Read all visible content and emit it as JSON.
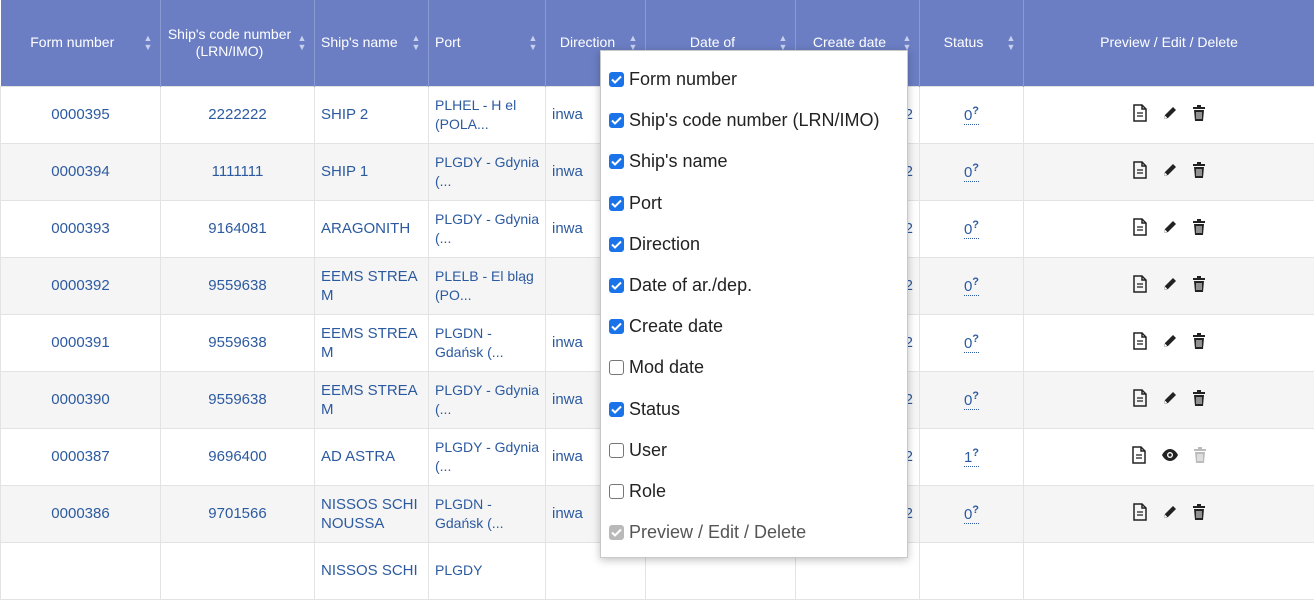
{
  "table": {
    "headers": {
      "form_number": "Form number",
      "ship_code": "Ship's code number (LRN/IMO)",
      "ship_name": "Ship's name",
      "port": "Port",
      "direction": "Direction",
      "date": "Date of",
      "create_date": "Create date",
      "status": "Status",
      "actions": "Preview / Edit / Delete"
    },
    "rows": [
      {
        "form": "0000395",
        "code": "2222222",
        "name": "SHIP 2",
        "port": "PLHEL - H el (POLA...",
        "dir": "inwa",
        "cd": "2",
        "status": "0",
        "del_disabled": false,
        "view_icon": "pencil"
      },
      {
        "form": "0000394",
        "code": "1111111",
        "name": "SHIP 1",
        "port": "PLGDY - Gdynia (...",
        "dir": "inwa",
        "cd": "2",
        "status": "0",
        "del_disabled": false,
        "view_icon": "pencil"
      },
      {
        "form": "0000393",
        "code": "9164081",
        "name": "ARAGONITH",
        "port": "PLGDY - Gdynia (...",
        "dir": "inwa",
        "cd": "2",
        "status": "0",
        "del_disabled": false,
        "view_icon": "pencil"
      },
      {
        "form": "0000392",
        "code": "9559638",
        "name": "EEMS STREA M",
        "port": "PLELB - El bląg (PO...",
        "dir": "",
        "cd": "2",
        "status": "0",
        "del_disabled": false,
        "view_icon": "pencil"
      },
      {
        "form": "0000391",
        "code": "9559638",
        "name": "EEMS STREA M",
        "port": "PLGDN - Gdańsk (...",
        "dir": "inwa",
        "cd": "2",
        "status": "0",
        "del_disabled": false,
        "view_icon": "pencil"
      },
      {
        "form": "0000390",
        "code": "9559638",
        "name": "EEMS STREA M",
        "port": "PLGDY - Gdynia (...",
        "dir": "inwa",
        "cd": "2",
        "status": "0",
        "del_disabled": false,
        "view_icon": "pencil"
      },
      {
        "form": "0000387",
        "code": "9696400",
        "name": "AD ASTRA",
        "port": "PLGDY - Gdynia (...",
        "dir": "inwa",
        "cd": "2",
        "status": "1",
        "del_disabled": true,
        "view_icon": "eye"
      },
      {
        "form": "0000386",
        "code": "9701566",
        "name": "NISSOS SCHI NOUSSA",
        "port": "PLGDN - Gdańsk (...",
        "dir": "inwa",
        "cd": "2",
        "status": "0",
        "del_disabled": false,
        "view_icon": "pencil"
      },
      {
        "form": "",
        "code": "",
        "name": "NISSOS SCHI",
        "port": "PLGDY",
        "dir": "",
        "cd": "",
        "status": "",
        "del_disabled": false,
        "view_icon": "pencil"
      }
    ],
    "status_suffix": "?"
  },
  "column_menu": {
    "options": [
      {
        "label": "Form number",
        "checked": true,
        "disabled": false
      },
      {
        "label": "Ship's code number (LRN/IMO)",
        "checked": true,
        "disabled": false
      },
      {
        "label": "Ship's name",
        "checked": true,
        "disabled": false
      },
      {
        "label": "Port",
        "checked": true,
        "disabled": false
      },
      {
        "label": "Direction",
        "checked": true,
        "disabled": false
      },
      {
        "label": "Date of ar./dep.",
        "checked": true,
        "disabled": false
      },
      {
        "label": "Create date",
        "checked": true,
        "disabled": false
      },
      {
        "label": "Mod date",
        "checked": false,
        "disabled": false
      },
      {
        "label": "Status",
        "checked": true,
        "disabled": false
      },
      {
        "label": "User",
        "checked": false,
        "disabled": false
      },
      {
        "label": "Role",
        "checked": false,
        "disabled": false
      },
      {
        "label": "Preview / Edit / Delete",
        "checked": true,
        "disabled": true
      }
    ]
  },
  "colors": {
    "header_bg": "#6b7ec4",
    "link": "#2c5aa0",
    "checkbox": "#1a73e8"
  }
}
